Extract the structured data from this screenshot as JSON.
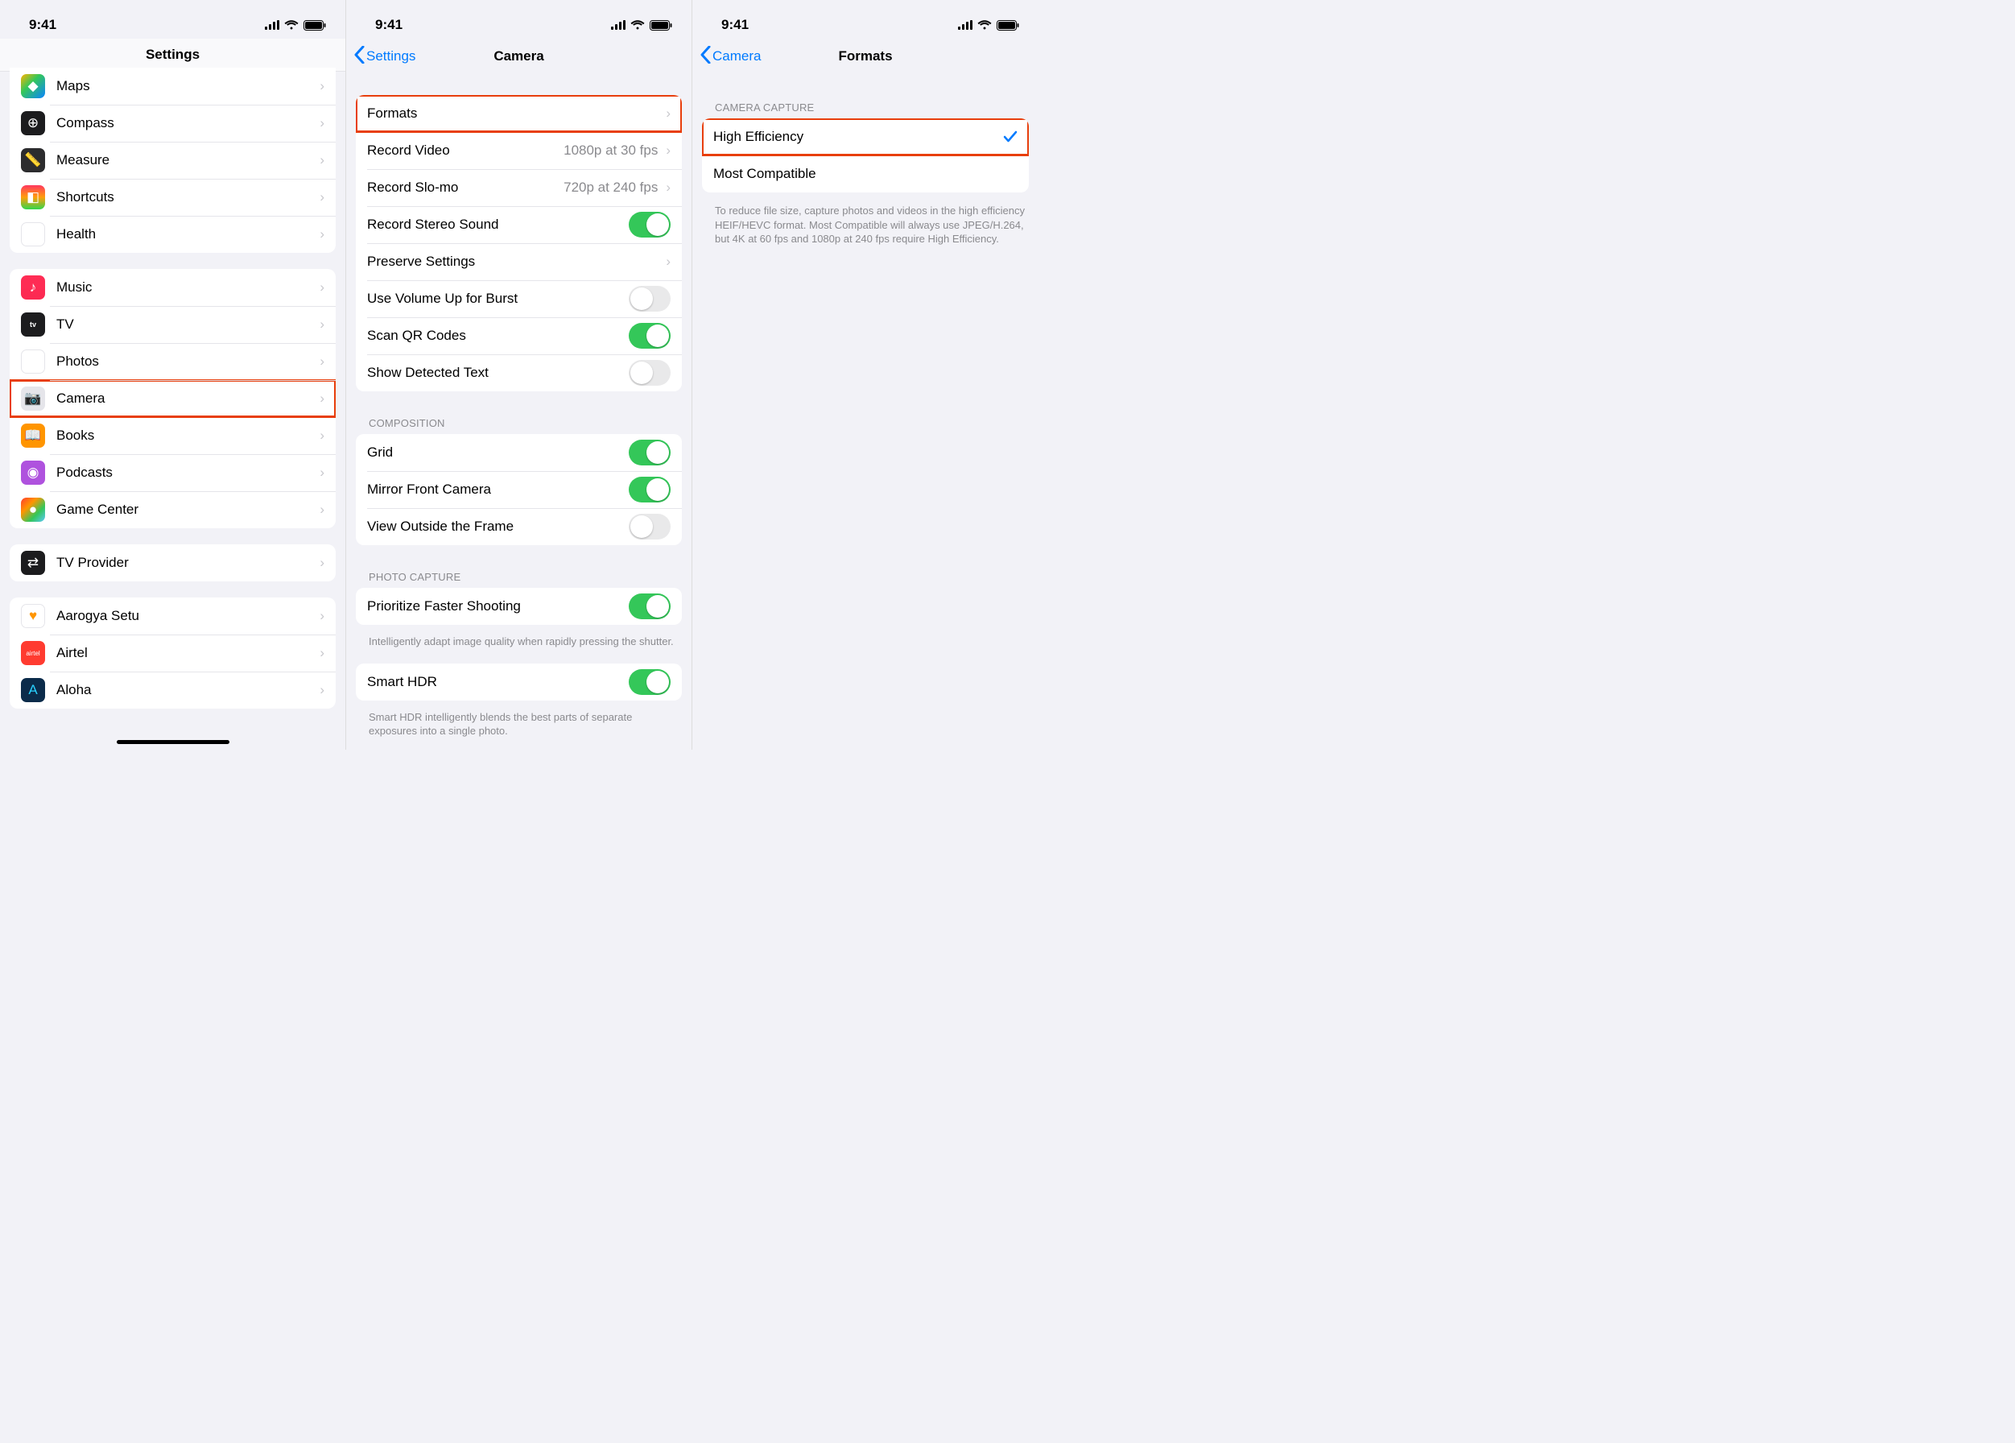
{
  "status": {
    "time": "9:41"
  },
  "screen1": {
    "title": "Settings",
    "groupA": [
      {
        "label": "Maps",
        "icon_name": "maps-icon"
      },
      {
        "label": "Compass",
        "icon_name": "compass-icon"
      },
      {
        "label": "Measure",
        "icon_name": "measure-icon"
      },
      {
        "label": "Shortcuts",
        "icon_name": "shortcuts-icon"
      },
      {
        "label": "Health",
        "icon_name": "health-icon"
      }
    ],
    "groupB": [
      {
        "label": "Music",
        "icon_name": "music-icon"
      },
      {
        "label": "TV",
        "icon_name": "tv-icon"
      },
      {
        "label": "Photos",
        "icon_name": "photos-icon"
      },
      {
        "label": "Camera",
        "icon_name": "camera-icon",
        "highlighted": true
      },
      {
        "label": "Books",
        "icon_name": "books-icon"
      },
      {
        "label": "Podcasts",
        "icon_name": "podcasts-icon"
      },
      {
        "label": "Game Center",
        "icon_name": "gamecenter-icon"
      }
    ],
    "groupC": [
      {
        "label": "TV Provider",
        "icon_name": "tvprovider-icon"
      }
    ],
    "groupD": [
      {
        "label": "Aarogya Setu",
        "icon_name": "aarogya-icon"
      },
      {
        "label": "Airtel",
        "icon_name": "airtel-icon"
      },
      {
        "label": "Aloha",
        "icon_name": "aloha-icon"
      }
    ]
  },
  "screen2": {
    "title": "Camera",
    "back_label": "Settings",
    "group1": [
      {
        "label": "Formats",
        "type": "disclosure",
        "highlighted": true
      },
      {
        "label": "Record Video",
        "type": "disclosure",
        "detail": "1080p at 30 fps"
      },
      {
        "label": "Record Slo-mo",
        "type": "disclosure",
        "detail": "720p at 240 fps"
      },
      {
        "label": "Record Stereo Sound",
        "type": "switch",
        "on": true
      },
      {
        "label": "Preserve Settings",
        "type": "disclosure"
      },
      {
        "label": "Use Volume Up for Burst",
        "type": "switch",
        "on": false
      },
      {
        "label": "Scan QR Codes",
        "type": "switch",
        "on": true
      },
      {
        "label": "Show Detected Text",
        "type": "switch",
        "on": false
      }
    ],
    "group2_header": "Composition",
    "group2": [
      {
        "label": "Grid",
        "type": "switch",
        "on": true
      },
      {
        "label": "Mirror Front Camera",
        "type": "switch",
        "on": true
      },
      {
        "label": "View Outside the Frame",
        "type": "switch",
        "on": false
      }
    ],
    "group3_header": "Photo Capture",
    "group3": [
      {
        "label": "Prioritize Faster Shooting",
        "type": "switch",
        "on": true
      }
    ],
    "group3_footer": "Intelligently adapt image quality when rapidly pressing the shutter.",
    "group4": [
      {
        "label": "Smart HDR",
        "type": "switch",
        "on": true
      }
    ],
    "group4_footer": "Smart HDR intelligently blends the best parts of separate exposures into a single photo."
  },
  "screen3": {
    "title": "Formats",
    "back_label": "Camera",
    "group_header": "Camera Capture",
    "options": [
      {
        "label": "High Efficiency",
        "selected": true,
        "highlighted": true
      },
      {
        "label": "Most Compatible",
        "selected": false
      }
    ],
    "group_footer": "To reduce file size, capture photos and videos in the high efficiency HEIF/HEVC format. Most Compatible will always use JPEG/H.264, but 4K at 60 fps and 1080p at 240 fps require High Efficiency."
  }
}
